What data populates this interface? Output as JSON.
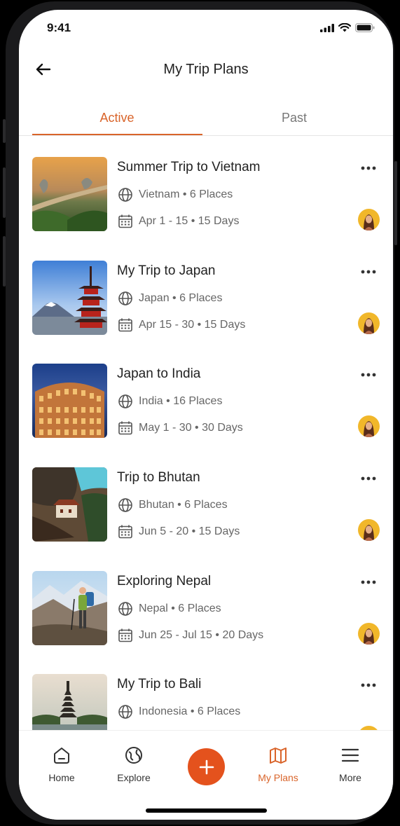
{
  "status": {
    "time": "9:41"
  },
  "header": {
    "title": "My Trip Plans"
  },
  "tabs": [
    {
      "label": "Active"
    },
    {
      "label": "Past"
    }
  ],
  "trips": [
    {
      "title": "Summer Trip to Vietnam",
      "place": "Vietnam • 6 Places",
      "dates": "Apr 1 - 15 • 15 Days"
    },
    {
      "title": "My Trip to Japan",
      "place": "Japan • 6 Places",
      "dates": "Apr 15 - 30 • 15 Days"
    },
    {
      "title": "Japan to India",
      "place": "India • 16 Places",
      "dates": "May 1 - 30 • 30 Days"
    },
    {
      "title": "Trip to Bhutan",
      "place": "Bhutan • 6 Places",
      "dates": "Jun 5 - 20 • 15 Days"
    },
    {
      "title": "Exploring Nepal",
      "place": "Nepal • 6 Places",
      "dates": "Jun 25 - Jul 15 • 20 Days"
    },
    {
      "title": "My Trip to Bali",
      "place": "Indonesia • 6 Places",
      "dates": ""
    }
  ],
  "nav": [
    {
      "label": "Home",
      "icon": "home-icon"
    },
    {
      "label": "Explore",
      "icon": "explore-icon"
    },
    {
      "label": "My Plans",
      "icon": "map-icon"
    },
    {
      "label": "More",
      "icon": "menu-icon"
    }
  ],
  "colors": {
    "accent": "#d9642a",
    "fab": "#e4521d",
    "avatar": "#f1b72a"
  }
}
